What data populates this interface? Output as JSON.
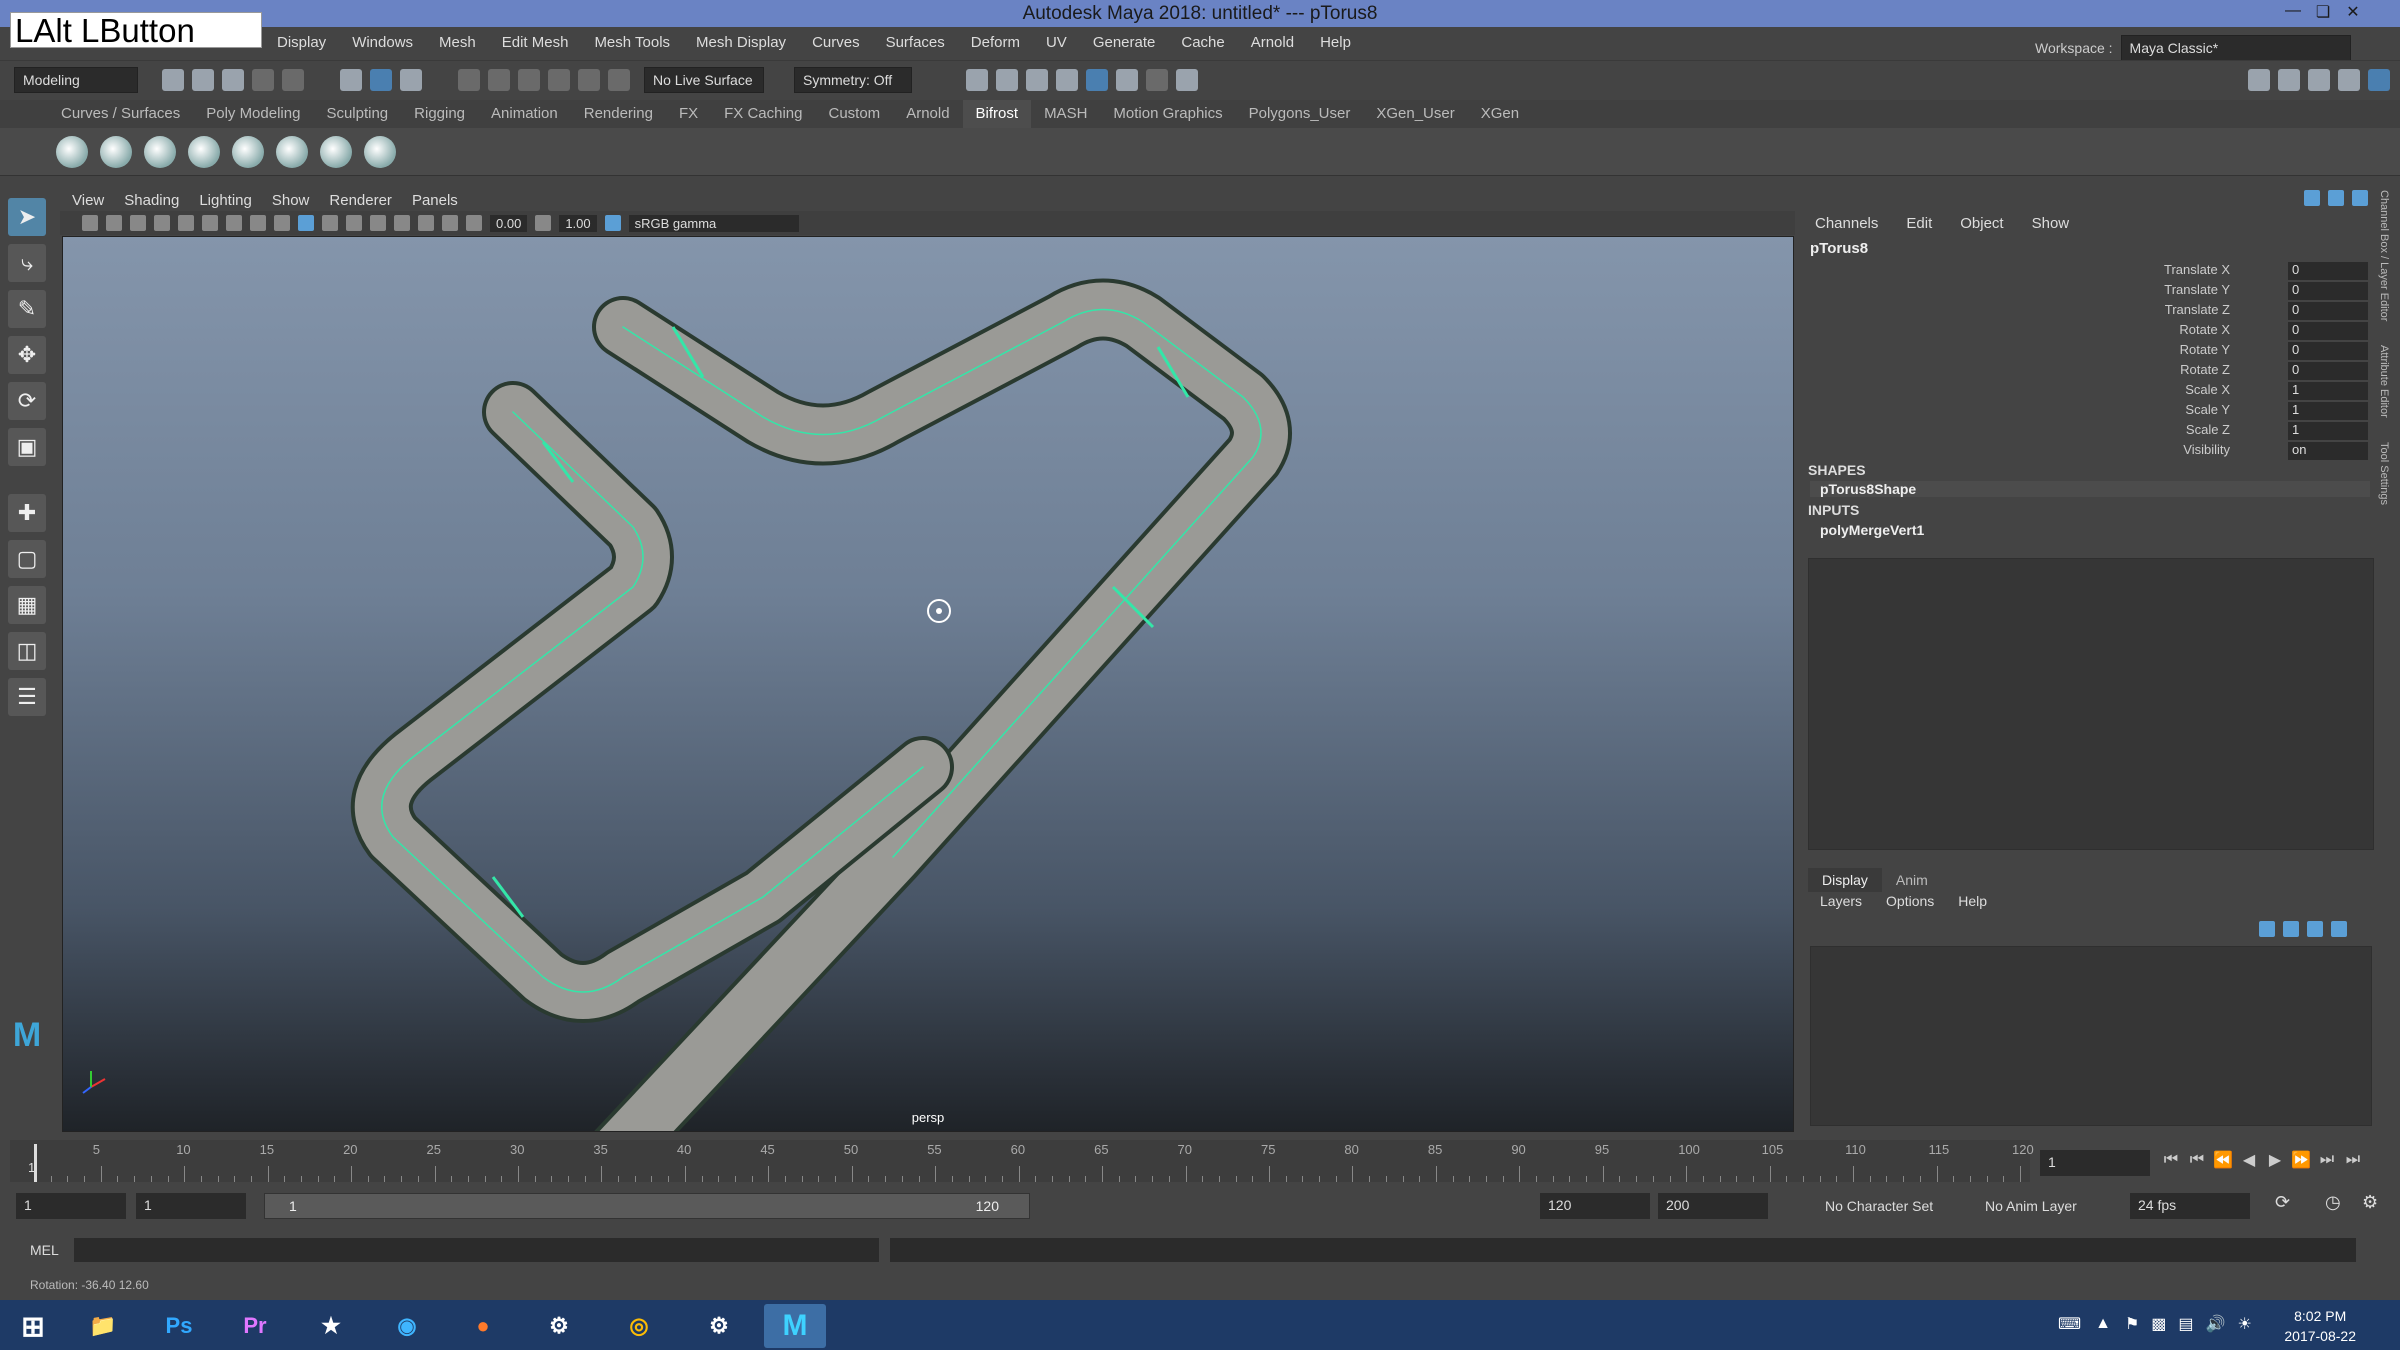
{
  "title": "Autodesk Maya 2018: untitled*   ---   pTorus8",
  "overlay_text": "LAlt LButton",
  "menu": [
    "Display",
    "Windows",
    "Mesh",
    "Edit Mesh",
    "Mesh Tools",
    "Mesh Display",
    "Curves",
    "Surfaces",
    "Deform",
    "UV",
    "Generate",
    "Cache",
    "Arnold",
    "Help"
  ],
  "workspace_label": "Workspace :",
  "workspace_value": "Maya Classic*",
  "mode_menu": "Modeling",
  "live_surface": "No Live Surface",
  "symmetry": "Symmetry: Off",
  "shelf_tabs": [
    "Curves / Surfaces",
    "Poly Modeling",
    "Sculpting",
    "Rigging",
    "Animation",
    "Rendering",
    "FX",
    "FX Caching",
    "Custom",
    "Arnold",
    "Bifrost",
    "MASH",
    "Motion Graphics",
    "Polygons_User",
    "XGen_User",
    "XGen"
  ],
  "shelf_active": "Bifrost",
  "viewport_menu": [
    "View",
    "Shading",
    "Lighting",
    "Show",
    "Renderer",
    "Panels"
  ],
  "viewport_fields": {
    "exposure": "0.00",
    "gamma": "1.00",
    "colorspace": "sRGB gamma"
  },
  "viewport_label": "persp",
  "channelbox_menu": [
    "Channels",
    "Edit",
    "Object",
    "Show"
  ],
  "object_name": "pTorus8",
  "attributes": [
    {
      "name": "Translate X",
      "value": "0"
    },
    {
      "name": "Translate Y",
      "value": "0"
    },
    {
      "name": "Translate Z",
      "value": "0"
    },
    {
      "name": "Rotate X",
      "value": "0"
    },
    {
      "name": "Rotate Y",
      "value": "0"
    },
    {
      "name": "Rotate Z",
      "value": "0"
    },
    {
      "name": "Scale X",
      "value": "1"
    },
    {
      "name": "Scale Y",
      "value": "1"
    },
    {
      "name": "Scale Z",
      "value": "1"
    },
    {
      "name": "Visibility",
      "value": "on"
    }
  ],
  "shapes_header": "SHAPES",
  "shape_node": "pTorus8Shape",
  "inputs_header": "INPUTS",
  "input_node": "polyMergeVert1",
  "layer_tabs": [
    "Display",
    "Anim"
  ],
  "layer_menu": [
    "Layers",
    "Options",
    "Help"
  ],
  "side_tabs": [
    "Channel Box / Layer Editor",
    "Attribute Editor",
    "Tool Settings"
  ],
  "timeline_ticks": [
    "5",
    "10",
    "15",
    "20",
    "25",
    "30",
    "35",
    "40",
    "45",
    "50",
    "55",
    "60",
    "65",
    "70",
    "75",
    "80",
    "85",
    "90",
    "95",
    "100",
    "105",
    "110",
    "115",
    "120"
  ],
  "timeline_start": "1",
  "current_frame": "1",
  "range": {
    "start": "1",
    "anim_start": "1",
    "slider_start": "1",
    "slider_end": "120",
    "end": "120",
    "anim_end": "200"
  },
  "character_set": "No Character Set",
  "anim_layer": "No Anim Layer",
  "fps": "24 fps",
  "cmd_label": "MEL",
  "help_line": "Rotation:  -36.40     12.60",
  "clock_time": "8:02 PM",
  "clock_date": "2017-08-22",
  "taskbar_apps": [
    "Ps",
    "Pr"
  ]
}
